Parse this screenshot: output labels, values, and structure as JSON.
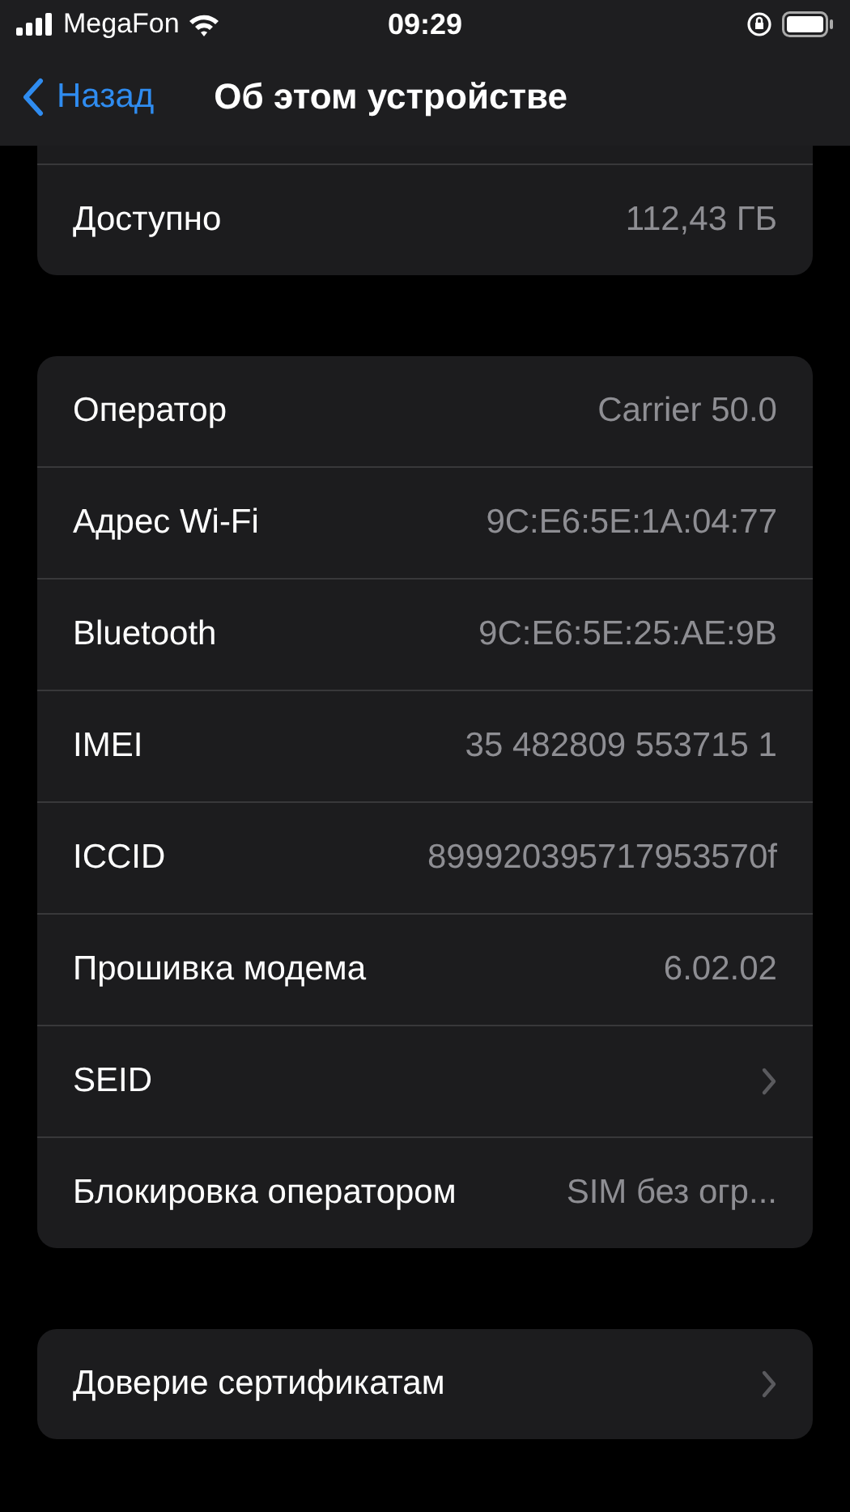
{
  "status_bar": {
    "carrier": "MegaFon",
    "time": "09:29"
  },
  "nav": {
    "back": "Назад",
    "title": "Об этом устройстве"
  },
  "groups": [
    {
      "cut_top": true,
      "rows": [
        {
          "kind": "value",
          "label": "Доступно",
          "value": "112,43 ГБ"
        }
      ]
    },
    {
      "cut_top": false,
      "rows": [
        {
          "kind": "value",
          "label": "Оператор",
          "value": "Carrier 50.0"
        },
        {
          "kind": "value",
          "label": "Адрес Wi-Fi",
          "value": "9C:E6:5E:1A:04:77"
        },
        {
          "kind": "value",
          "label": "Bluetooth",
          "value": "9C:E6:5E:25:AE:9B"
        },
        {
          "kind": "value",
          "label": "IMEI",
          "value": "35 482809 553715 1"
        },
        {
          "kind": "value",
          "label": "ICCID",
          "value": "899920395717953570f"
        },
        {
          "kind": "value",
          "label": "Прошивка модема",
          "value": "6.02.02"
        },
        {
          "kind": "link",
          "label": "SEID"
        },
        {
          "kind": "value",
          "label": "Блокировка оператором",
          "value": "SIM без огр..."
        }
      ]
    },
    {
      "cut_top": false,
      "rows": [
        {
          "kind": "link",
          "label": "Доверие сертификатам"
        }
      ]
    }
  ]
}
